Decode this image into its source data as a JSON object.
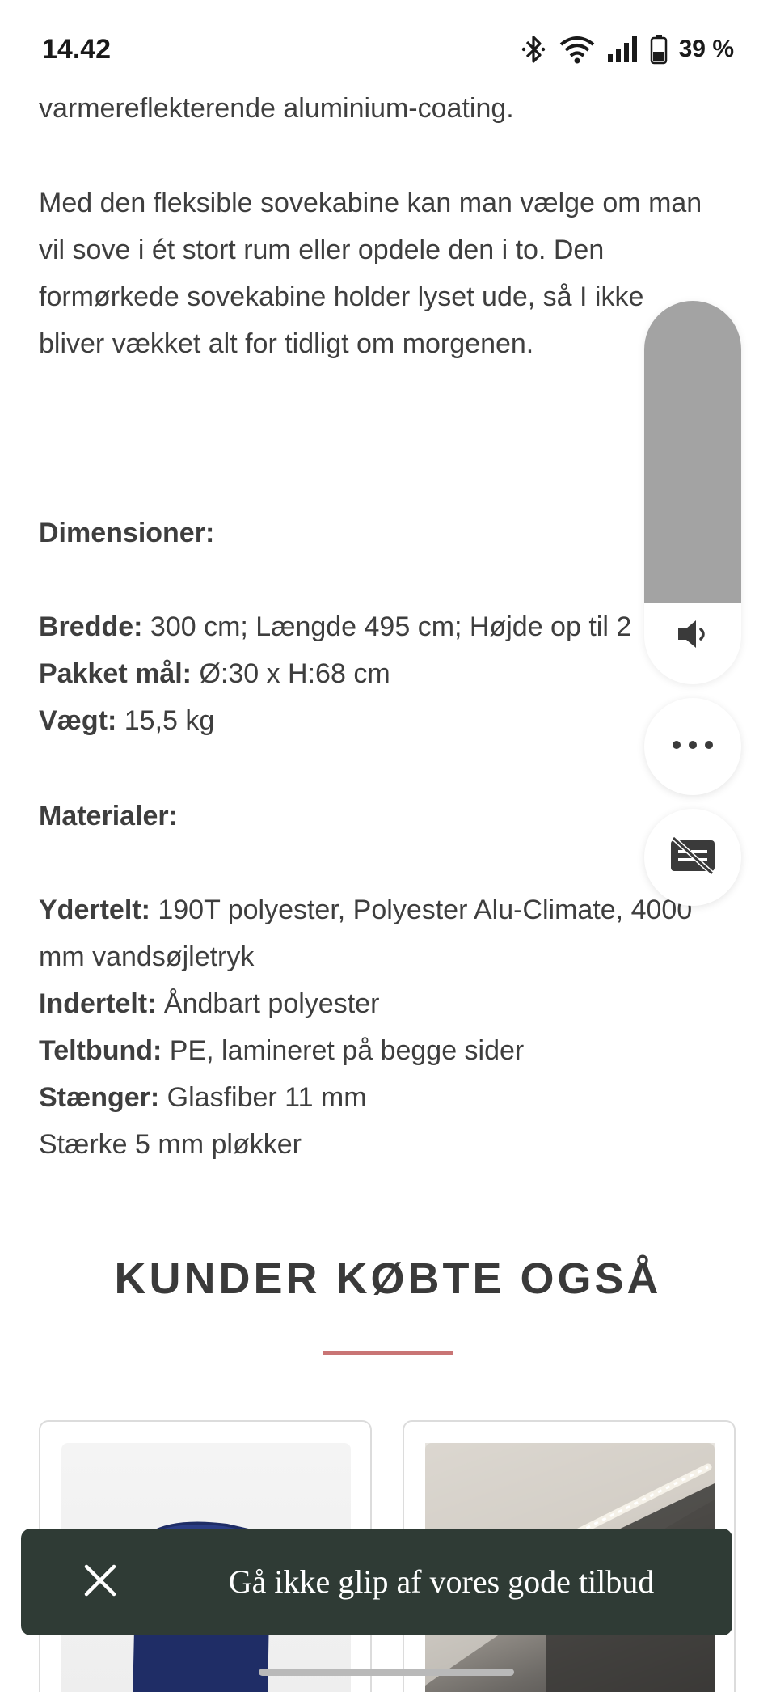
{
  "status_bar": {
    "time": "14.42",
    "battery_percent": "39 %",
    "icons": [
      "bluetooth-icon",
      "wifi-icon",
      "cellular-signal-icon",
      "battery-icon"
    ]
  },
  "article": {
    "paragraph_1_tail": "varmereflekterende aluminium-coating.",
    "paragraph_2_lines": [
      "Med den fleksible sovekabine kan man vælge om man",
      "vil sove i ét stort rum eller opdele den i to. Den",
      "formørkede sovekabine holder lyset ude, så I ikke",
      "bliver vækket alt for tidligt om morgenen."
    ],
    "dimensions": {
      "heading": "Dimensioner:",
      "rows": [
        {
          "label": "Bredde:",
          "value": " 300 cm; Længde 495 cm; Højde op til 2"
        },
        {
          "label": "Pakket mål:",
          "value": " Ø:30 x H:68 cm"
        },
        {
          "label": "Vægt:",
          "value": " 15,5 kg"
        }
      ]
    },
    "materials": {
      "heading": "Materialer:",
      "rows": [
        {
          "label": "Ydertelt:",
          "value": " 190T polyester, Polyester Alu-Climate, 4000"
        },
        {
          "label": "",
          "value": "mm vandsøjletryk"
        },
        {
          "label": "Indertelt:",
          "value": " Åndbart polyester"
        },
        {
          "label": "Teltbund:",
          "value": " PE, lamineret på begge sider"
        },
        {
          "label": "Stænger:",
          "value": " Glasfiber 11 mm"
        },
        {
          "label": "",
          "value": "Stærke 5 mm pløkker"
        }
      ]
    }
  },
  "related": {
    "title": "KUNDER KØBTE OGSÅ",
    "accent_color": "#c97575",
    "products": [
      {
        "image": "blue-product-image"
      },
      {
        "image": "tent-light-image"
      }
    ]
  },
  "overlay": {
    "volume_level": 0.79,
    "volume_icon": "speaker-icon",
    "more_icon": "more-horizontal-icon",
    "caption_icon": "captions-off-icon"
  },
  "toast": {
    "message": "Gå ikke glip af vores gode tilbud",
    "close_icon": "close-icon",
    "background": "#2f3b35"
  }
}
